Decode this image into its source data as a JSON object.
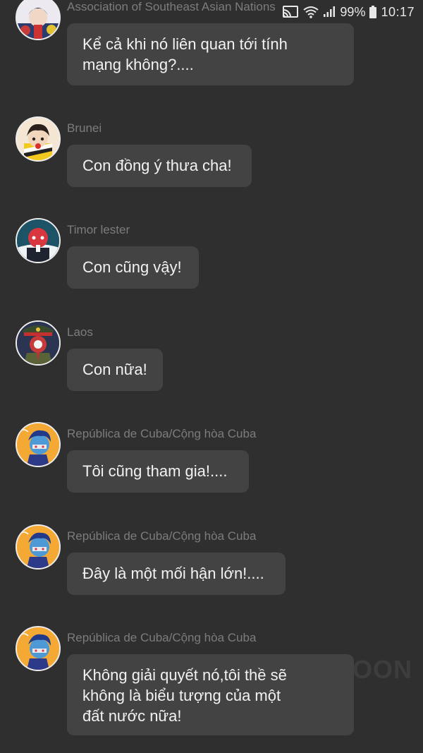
{
  "status_bar": {
    "battery": "99%",
    "time": "10:17"
  },
  "watermark": "OON",
  "messages": [
    {
      "sender": "Association of Southeast Asian Nations",
      "text_lines": [
        "Kể cả khi nó liên quan tới tính",
        "mạng không?...."
      ],
      "avatar": "asean-avatar-icon"
    },
    {
      "sender": "Brunei",
      "text_lines": [
        "Con đồng ý thưa cha!"
      ],
      "avatar": "brunei-avatar-icon"
    },
    {
      "sender": "Timor lester",
      "text_lines": [
        "Con cũng vậy!"
      ],
      "avatar": "timor-avatar-icon"
    },
    {
      "sender": "Laos",
      "text_lines": [
        "Con nữa!"
      ],
      "avatar": "laos-avatar-icon"
    },
    {
      "sender": "República de Cuba/Cộng hòa Cuba",
      "text_lines": [
        "Tôi cũng tham gia!...."
      ],
      "avatar": "cuba-avatar-icon"
    },
    {
      "sender": "República de Cuba/Cộng hòa Cuba",
      "text_lines": [
        "Đây là một mối hận lớn!...."
      ],
      "avatar": "cuba-avatar-icon"
    },
    {
      "sender": "República de Cuba/Cộng hòa Cuba",
      "text_lines": [
        "Không giải quyết nó,tôi thề sẽ",
        "không là biểu tượng của một",
        "đất nước nữa!"
      ],
      "avatar": "cuba-avatar-icon"
    }
  ]
}
